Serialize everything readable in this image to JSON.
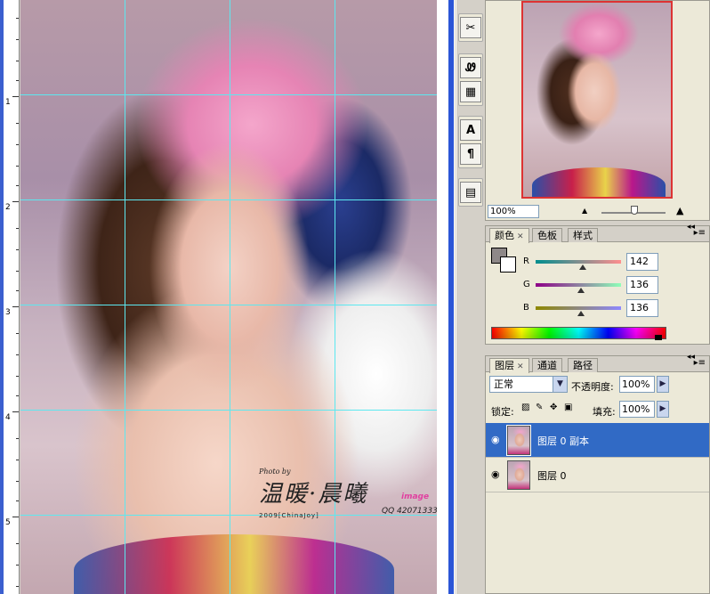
{
  "ruler": {
    "numbers": [
      "1",
      "2",
      "3",
      "4",
      "5"
    ]
  },
  "canvas": {
    "watermark": {
      "photo_by": "Photo by",
      "name": "温暖·晨曦",
      "image": "image",
      "qq": "QQ 42071333",
      "chinajoy": "2009[ChinaJoy]"
    }
  },
  "tools": {
    "items": [
      "clone-stamp-icon",
      "history-brush-icon",
      "paint-bucket-icon",
      "type-icon",
      "paragraph-icon",
      "layer-comps-icon"
    ],
    "glyphs": [
      "✂",
      "Ꮺ",
      "▦",
      "A",
      "¶",
      "▤"
    ]
  },
  "navigator": {
    "zoom_value": "100%"
  },
  "color_panel": {
    "tabs": [
      "颜色",
      "色板",
      "样式"
    ],
    "channels": [
      {
        "label": "R",
        "value": "142",
        "level": 0.557,
        "gradient": "linear-gradient(90deg,#008e8e,#ff8e8e)"
      },
      {
        "label": "G",
        "value": "136",
        "level": 0.533,
        "gradient": "linear-gradient(90deg,#8e0088,#8effb8)"
      },
      {
        "label": "B",
        "value": "136",
        "level": 0.533,
        "gradient": "linear-gradient(90deg,#8e8800,#8e88ff)"
      }
    ],
    "foreground_color": "#8e8888",
    "background_color": "#ffffff"
  },
  "layers_panel": {
    "tabs": [
      "图层",
      "通道",
      "路径"
    ],
    "blend_mode": "正常",
    "opacity_label": "不透明度:",
    "opacity_value": "100%",
    "lock_label": "锁定:",
    "fill_label": "填充:",
    "fill_value": "100%",
    "layers": [
      {
        "name": "图层 0 副本",
        "selected": true
      },
      {
        "name": "图层 0",
        "selected": false
      }
    ]
  },
  "colors": {
    "guide": "#5ce8f0",
    "selection": "#316ac5",
    "panel_bg": "#ece9d8",
    "nav_frame": "#dd3333"
  }
}
